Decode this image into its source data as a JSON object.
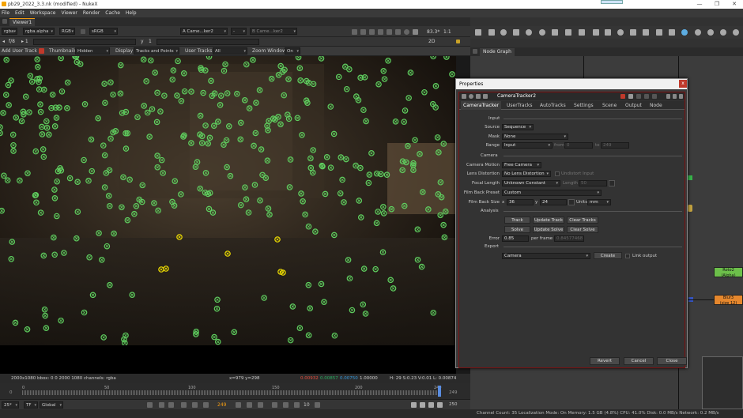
{
  "window": {
    "title": "pb29_2022_3.3.nk (modified) - NukeX",
    "controls": [
      "—",
      "❐",
      "✕"
    ]
  },
  "menu": [
    "File",
    "Edit",
    "Workspace",
    "Viewer",
    "Render",
    "Cache",
    "Help"
  ],
  "viewer_tab": "Viewer1",
  "viewer_toolbar": {
    "channels": "rgba",
    "alpha": "rgba.alpha",
    "colorspace_mode": "RGB",
    "display": "sRGB",
    "input_a": "A  Came...ker2",
    "input_a_op": "-",
    "input_b": "B  Came...ker2",
    "zoom": "83.3*",
    "ratio": "1:1",
    "view_mode": "2D",
    "frame_label": "f/8",
    "frame_step": "1",
    "y_label": "y",
    "y_value": "1"
  },
  "tracker_toolbar": {
    "add_user_track": "Add User Track",
    "thumbnails_label": "Thumbnails",
    "thumbnails_value": "Hidden",
    "display_label": "Display",
    "display_value": "Tracks and Points",
    "user_tracks_label": "User Tracks",
    "user_tracks_value": "All",
    "zoom_window_label": "Zoom Window",
    "zoom_window_value": "On"
  },
  "infobar": {
    "format": "2000x1080  bbox: 0 0 2000 1080 channels: rgba",
    "coords": "x=979 y=298",
    "r": "0.00932",
    "g": "0.00857",
    "b": "0.00750",
    "a": "1.00000",
    "hsv": "H: 29 S:0.23 V:0.01  L: 0.00874"
  },
  "timeline": {
    "start": "0",
    "ticks": [
      "0",
      "50",
      "100",
      "150",
      "200",
      "249"
    ],
    "end": "249",
    "current_frame": "249",
    "increment": "10",
    "fps_display": "250",
    "left_frame": "0"
  },
  "playbar": {
    "fps": "25*",
    "tf": "TF",
    "global": "Global"
  },
  "statusbar": "Channel Count: 35  Localization Mode: On  Memory: 1.5 GB (4.8%)  CPU: 41.0%  Disk: 0.0 MB/s  Network: 0.2 MB/s",
  "node_graph_tab": "Node Graph",
  "properties": {
    "title": "Properties",
    "close": "x",
    "node_name": "CameraTracker2",
    "tabs": [
      "CameraTracker",
      "UserTracks",
      "AutoTracks",
      "Settings",
      "Scene",
      "Output",
      "Node"
    ],
    "input_section": "Input",
    "source_label": "Source",
    "source_value": "Sequence",
    "mask_label": "Mask",
    "mask_value": "None",
    "range_label": "Range",
    "range_value": "Input",
    "range_from_label": "from",
    "range_from": "0",
    "range_to_label": "to",
    "range_to": "249",
    "camera_section": "Camera",
    "camera_motion_label": "Camera Motion",
    "camera_motion_value": "Free Camera",
    "lens_distortion_label": "Lens Distortion",
    "lens_distortion_value": "No Lens Distortion",
    "undistort_label": "Undistort Input",
    "focal_length_label": "Focal Length",
    "focal_length_value": "Unknown Constant",
    "length_label": "Length",
    "length_value": "50",
    "film_back_preset_label": "Film Back Preset",
    "film_back_preset_value": "Custom",
    "film_back_size_label": "Film Back Size",
    "film_back_x_label": "x",
    "film_back_x": "36",
    "film_back_y_label": "y",
    "film_back_y": "24",
    "units_label": "Units",
    "units_value": "mm",
    "analysis_section": "Analysis",
    "track_btn": "Track",
    "update_track_btn": "Update Track",
    "clear_tracks_btn": "Clear Tracks",
    "solve_btn": "Solve",
    "update_solve_btn": "Update Solve",
    "clear_solve_btn": "Clear Solve",
    "error_label": "Error",
    "error_value": "0.85",
    "per_frame_label": "per frame",
    "per_frame_value": "0.84577468",
    "export_section": "Export",
    "export_value": "Camera",
    "create_btn": "Create",
    "link_output_label": "Link output",
    "revert_btn": "Revert",
    "cancel_btn": "Cancel",
    "close_btn": "Close"
  },
  "nodes": {
    "roto": "Roto2",
    "roto_sub": "(Alpha)",
    "blur": "Blur3",
    "blur_sub": "(size 12)"
  }
}
